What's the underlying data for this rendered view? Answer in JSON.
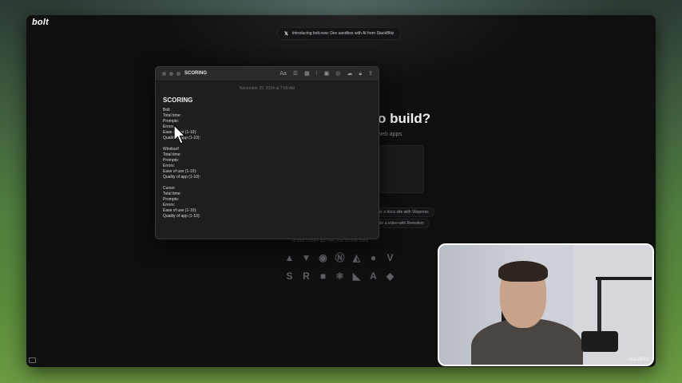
{
  "app": {
    "logo": "bolt",
    "announcement": "Introducing bolt.new: Dev sandbox with AI from StackBlitz",
    "hero_title": "o build?",
    "hero_subtitle": "web apps.",
    "suggestions": [
      "ate a docs site with Vitepress",
      "ode a video with Remotion"
    ],
    "blank_app_text": "or start a blank app with your favorite stack",
    "framework_icons_row1": [
      "astro-icon",
      "vite-icon",
      "nuxt-icon",
      "nextjs-icon",
      "remix-icon",
      "qwik-icon",
      "vue-icon"
    ],
    "framework_icons_row2": [
      "slidev-icon",
      "remotion-icon",
      "typescript-icon",
      "react-icon",
      "analog-icon",
      "angular-icon",
      "svelte-icon"
    ]
  },
  "notes": {
    "window_title": "SCORING",
    "date": "November 25, 2024 at 7:58 AM",
    "heading": "SCORING",
    "sections": [
      {
        "name": "Bolt",
        "lines": [
          "Total time:",
          "Prompts:",
          "Errors:",
          "Ease of use (1-10):",
          "Quality of app (1-10):"
        ]
      },
      {
        "name": "Windsurf",
        "lines": [
          "Total time:",
          "Prompts:",
          "Errors:",
          "Ease of use (1-10):",
          "Quality of app (1-10):"
        ]
      },
      {
        "name": "Cursor",
        "lines": [
          "Total time:",
          "Prompts:",
          "Errors:",
          "Ease of use (1-10):",
          "Quality of app (1-10):"
        ]
      }
    ],
    "toolbar_icons": [
      "font-format-icon",
      "checklist-icon",
      "table-icon",
      "audio-icon",
      "media-icon",
      "collaborate-icon",
      "link-icon",
      "lock-icon",
      "share-icon"
    ]
  },
  "webcam": {
    "overlay_text": "StackBlitz"
  }
}
